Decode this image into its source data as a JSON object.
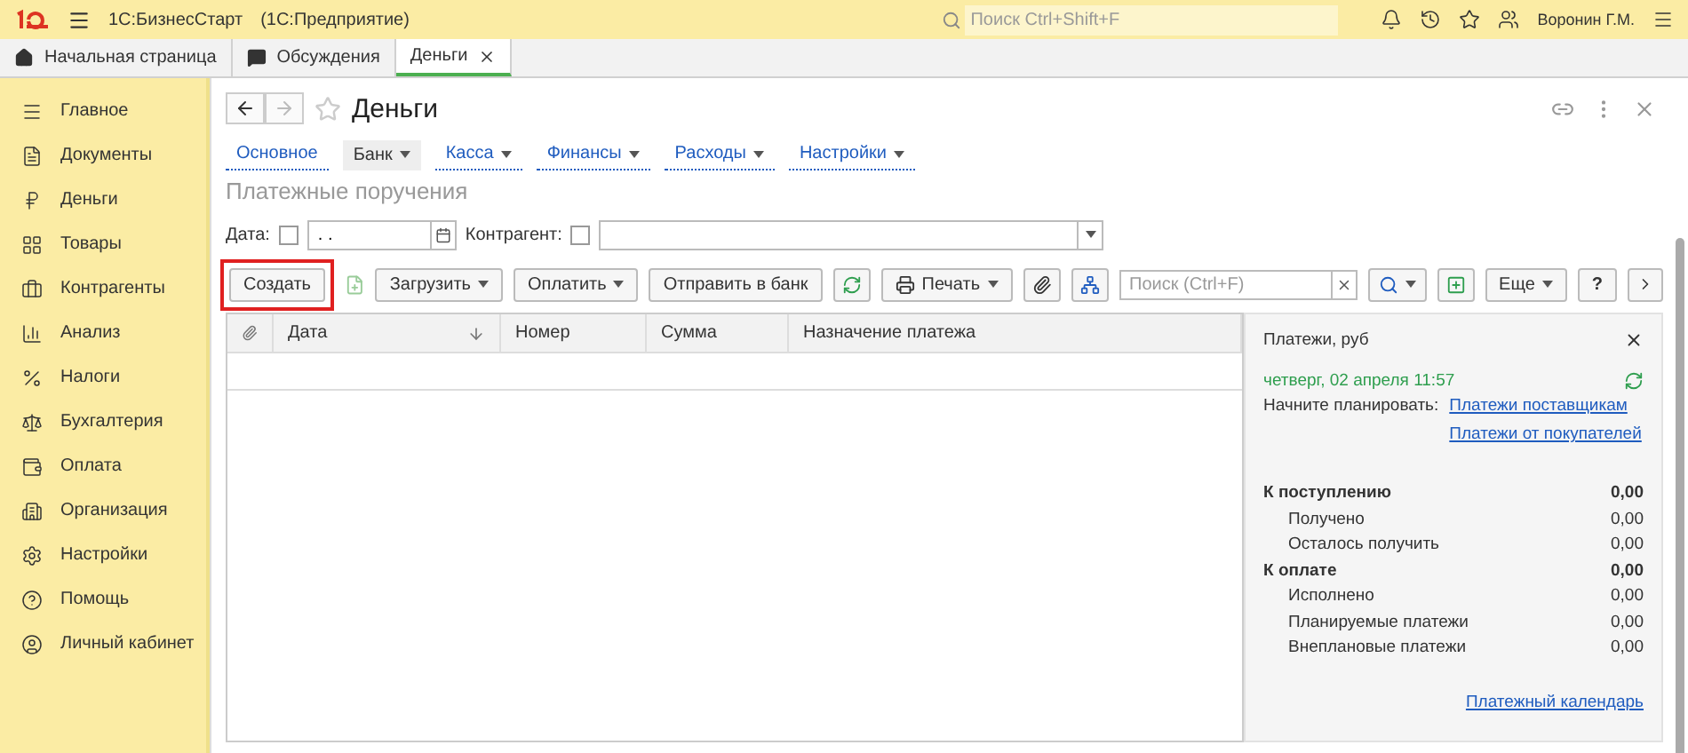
{
  "app_bar": {
    "title": "1С:БизнесСтарт",
    "subtitle": "(1С:Предприятие)",
    "search": {
      "placeholder": "Поиск Ctrl+Shift+F"
    },
    "user": "Воронин Г.М."
  },
  "open_tabs": [
    {
      "label": "Начальная страница",
      "selected": false,
      "closable": false
    },
    {
      "label": "Обсуждения",
      "selected": false,
      "closable": false
    },
    {
      "label": "Деньги",
      "selected": true,
      "closable": true
    }
  ],
  "sidebar": {
    "items": [
      {
        "label": "Главное"
      },
      {
        "label": "Документы"
      },
      {
        "label": "Деньги"
      },
      {
        "label": "Товары"
      },
      {
        "label": "Контрагенты"
      },
      {
        "label": "Анализ"
      },
      {
        "label": "Налоги"
      },
      {
        "label": "Бухгалтерия"
      },
      {
        "label": "Оплата"
      },
      {
        "label": "Организация"
      },
      {
        "label": "Настройки"
      },
      {
        "label": "Помощь"
      },
      {
        "label": "Личный кабинет"
      }
    ]
  },
  "form": {
    "title": "Деньги",
    "sections": [
      {
        "label": "Основное",
        "selected": false,
        "dropdown": false
      },
      {
        "label": "Банк",
        "selected": true,
        "dropdown": true
      },
      {
        "label": "Касса",
        "selected": false,
        "dropdown": true
      },
      {
        "label": "Финансы",
        "selected": false,
        "dropdown": true
      },
      {
        "label": "Расходы",
        "selected": false,
        "dropdown": true
      },
      {
        "label": "Настройки",
        "selected": false,
        "dropdown": true
      }
    ],
    "subtitle": "Платежные поручения",
    "filters": {
      "date_label": "Дата:",
      "date_checked": false,
      "date_value": ". .",
      "counterparty_label": "Контрагент:",
      "counterparty_checked": false
    },
    "toolbar": {
      "create": {
        "label": "Создать",
        "highlighted": true
      },
      "load": "Загрузить",
      "pay": "Оплатить",
      "send": "Отправить в банк",
      "print": "Печать",
      "search": {
        "placeholder": "Поиск (Ctrl+F)"
      },
      "more": "Еще",
      "help": "?"
    },
    "table": {
      "columns": [
        {
          "label": "Дата",
          "sorted": true
        },
        {
          "label": "Номер",
          "sorted": false
        },
        {
          "label": "Сумма",
          "sorted": false
        },
        {
          "label": "Назначение платежа",
          "sorted": false
        }
      ]
    },
    "payments_panel": {
      "title": "Платежи, руб",
      "date": "четверг, 02 апреля 11:57",
      "plan_label": "Начните планировать:",
      "links": [
        "Платежи поставщикам",
        "Платежи от покупателей"
      ],
      "rows": [
        {
          "kind": "total",
          "label": "К поступлению",
          "value": "0,00"
        },
        {
          "kind": "item",
          "label": "Получено",
          "value": "0,00"
        },
        {
          "kind": "item",
          "label": "Осталось получить",
          "value": "0,00"
        },
        {
          "kind": "total",
          "label": "К оплате",
          "value": "0,00"
        },
        {
          "kind": "item",
          "label": "Исполнено",
          "value": "0,00"
        },
        {
          "kind": "item",
          "label": "Планируемые платежи",
          "value": "0,00"
        },
        {
          "kind": "item",
          "label": "Внеплановые платежи",
          "value": "0,00"
        }
      ],
      "calendar_link": "Платежный календарь"
    }
  }
}
